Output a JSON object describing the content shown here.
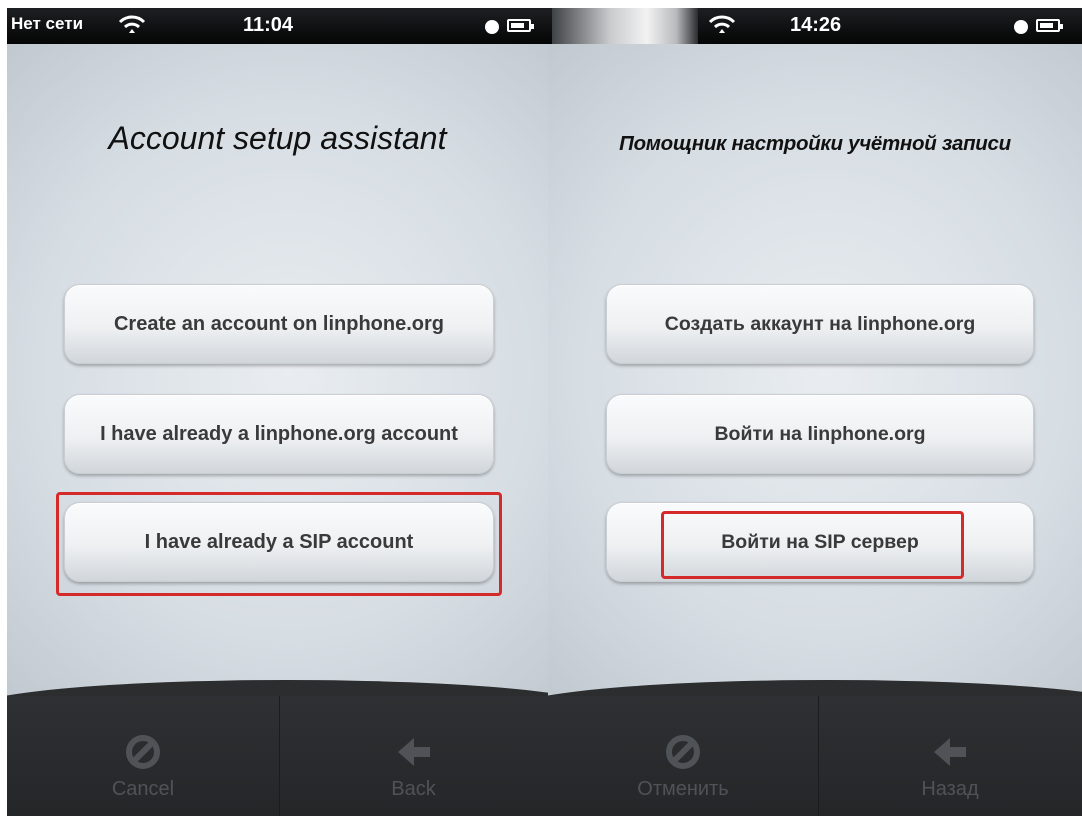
{
  "left": {
    "status": {
      "carrier": "Нет сети",
      "time": "11:04"
    },
    "title": "Account setup assistant",
    "buttons": {
      "create": "Create an account on linphone.org",
      "linphone": "I have already a linphone.org account",
      "sip": "I have already a SIP account"
    },
    "tabbar": {
      "cancel": "Cancel",
      "back": "Back"
    }
  },
  "right": {
    "status": {
      "time": "14:26"
    },
    "title": "Помощник настройки учётной записи",
    "buttons": {
      "create": "Создать аккаунт на linphone.org",
      "linphone": "Войти на linphone.org",
      "sip": "Войти на SIP сервер"
    },
    "tabbar": {
      "cancel": "Отменить",
      "back": "Назад"
    }
  },
  "colors": {
    "highlight": "#d42a2a",
    "tabbar": "#2b2d2f",
    "tab_label": "#4f5357"
  },
  "icons": {
    "cancel": "cancel-circle-slash-icon",
    "back": "back-arrow-icon",
    "wifi": "wifi-icon",
    "alarm": "alarm-icon",
    "battery": "battery-icon"
  }
}
